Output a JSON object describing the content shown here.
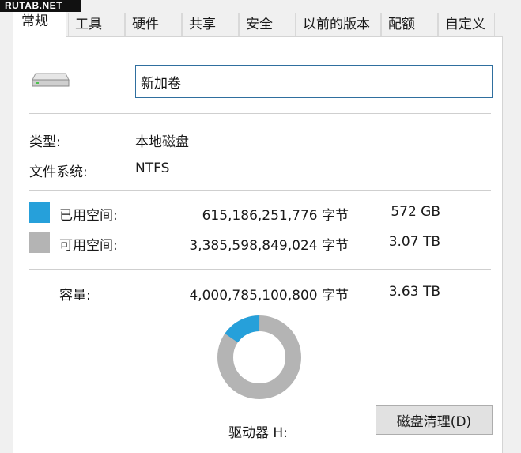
{
  "watermark": "RUTAB.NET",
  "tabs": [
    {
      "label": "常规",
      "active": true
    },
    {
      "label": "工具"
    },
    {
      "label": "硬件"
    },
    {
      "label": "共享"
    },
    {
      "label": "安全"
    },
    {
      "label": "以前的版本"
    },
    {
      "label": "配额"
    },
    {
      "label": "自定义"
    }
  ],
  "drive": {
    "icon": "drive-icon",
    "name_value": "新加卷"
  },
  "info": {
    "type_label": "类型:",
    "type_value": "本地磁盘",
    "fs_label": "文件系统:",
    "fs_value": "NTFS"
  },
  "usage": {
    "used": {
      "label": "已用空间:",
      "bytes": "615,186,251,776 字节",
      "short": "572 GB",
      "color": "#26a0da"
    },
    "free": {
      "label": "可用空间:",
      "bytes": "3,385,598,849,024 字节",
      "short": "3.07 TB",
      "color": "#b4b4b4"
    },
    "capacity": {
      "label": "容量:",
      "bytes": "4,000,785,100,800 字节",
      "short": "3.63 TB"
    },
    "used_fraction": 0.1538
  },
  "drive_label": "驱动器 H:",
  "cleanup_button": "磁盘清理(D)"
}
